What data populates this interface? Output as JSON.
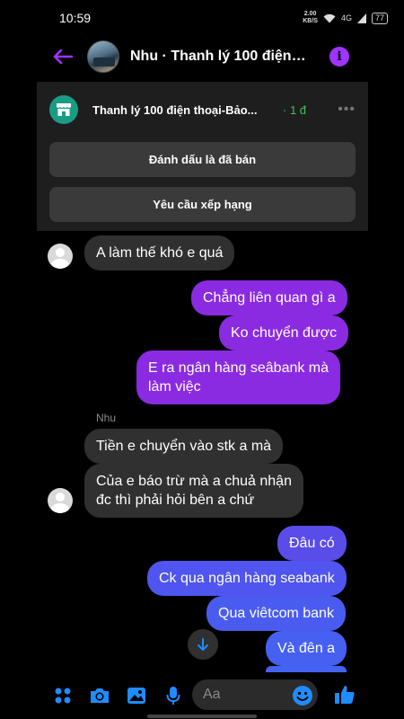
{
  "status_bar": {
    "time": "10:59",
    "net_speed_value": "2.00",
    "net_speed_unit": "KB/S",
    "network": "4G",
    "battery": "77"
  },
  "header": {
    "title": "Nhu · Thanh lý 100 điện t...",
    "info_icon": "i"
  },
  "listing": {
    "title": "Thanh lý 100 điện thoại-Bảo...",
    "price": "· 1 đ",
    "mark_sold_label": "Đánh dấu là đã bán",
    "request_rating_label": "Yêu cầu xếp hạng"
  },
  "messages": [
    {
      "direction": "in",
      "text": "A làm thế khó e quá"
    },
    {
      "direction": "out",
      "text": "Chẳng liên quan gì a"
    },
    {
      "direction": "out",
      "text": "Ko chuyển được"
    },
    {
      "direction": "out",
      "text": "E ra ngân hàng seâbank mà\nlàm việc"
    },
    {
      "direction": "in",
      "sender": "Nhu",
      "text": "Tiền e chuyển vào stk a mà"
    },
    {
      "direction": "in",
      "text": "Của e báo trừ mà a chuả nhận\nđc thì phải hỏi bên a chứ"
    },
    {
      "direction": "out",
      "text": "Đâu có"
    },
    {
      "direction": "out",
      "text": "Ck qua ngân hàng seabank"
    },
    {
      "direction": "out",
      "text": "Qua viêtcom bank"
    },
    {
      "direction": "out",
      "text": "Và đên a"
    }
  ],
  "composer": {
    "placeholder": "Aa"
  },
  "colors": {
    "accent_purple": "#a033ff",
    "outgoing_bubble": "#8a2be2",
    "outgoing_bubble_bottom": "#4a5cf0",
    "incoming_bubble": "#303030",
    "icon_blue": "#1f8cff",
    "price_green": "#3ec45a"
  },
  "icons": [
    "back-arrow-icon",
    "info-icon",
    "shop-icon",
    "more-icon",
    "scroll-down-icon",
    "apps-icon",
    "camera-icon",
    "gallery-icon",
    "mic-icon",
    "emoji-icon",
    "thumbs-up-icon"
  ]
}
